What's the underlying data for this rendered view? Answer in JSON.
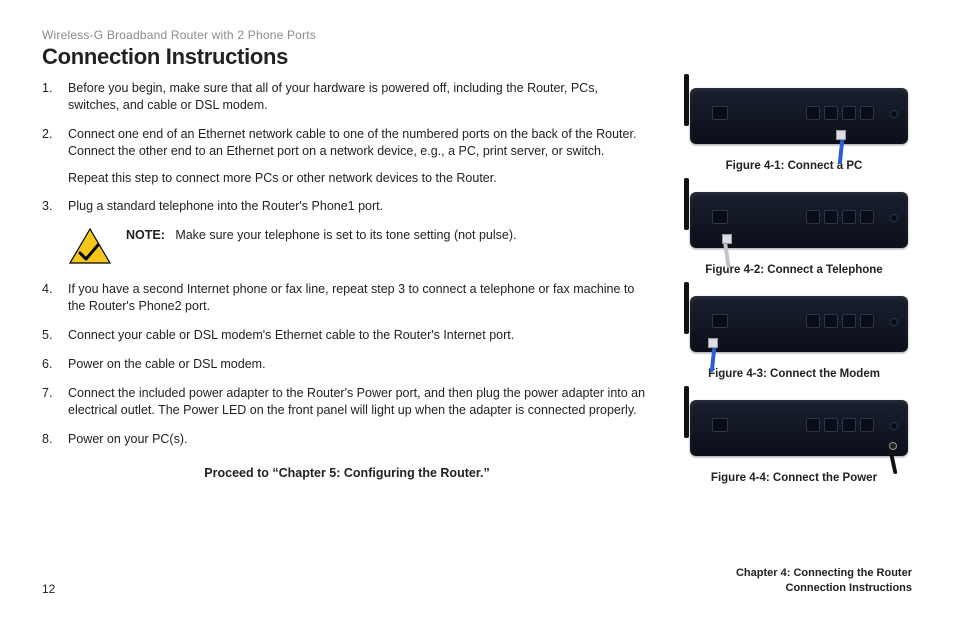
{
  "header": {
    "product": "Wireless-G Broadband Router with 2 Phone Ports",
    "title": "Connection Instructions"
  },
  "steps": {
    "s1": "Before you begin, make sure that all of your hardware is powered off, including the Router, PCs, switches, and cable or DSL modem.",
    "s2": "Connect one end of an Ethernet network cable to one of the numbered ports on the back of the Router. Connect the other end to an Ethernet port on a network device, e.g., a PC, print server, or switch.",
    "s2b": "Repeat this step to connect more PCs or other network devices to the Router.",
    "s3": "Plug a standard telephone into the Router's Phone1 port.",
    "note_label": "NOTE:",
    "note_text": "Make sure your telephone is set to its tone setting (not pulse).",
    "s4": "If you have a second Internet phone or fax line, repeat step 3 to connect a telephone or fax machine to the Router's Phone2 port.",
    "s5": "Connect your cable or DSL modem's Ethernet cable to the Router's Internet port.",
    "s6": "Power on the cable or DSL modem.",
    "s7": "Connect the included power adapter to the Router's Power port, and then plug the power adapter into an electrical outlet. The Power LED on the front panel will light up when the adapter is connected properly.",
    "s8": "Power on your PC(s).",
    "proceed": "Proceed to “Chapter 5: Configuring the Router.”"
  },
  "figures": {
    "f1": "Figure 4-1: Connect a PC",
    "f2": "Figure 4-2: Connect a Telephone",
    "f3": "Figure 4-3: Connect the Modem",
    "f4": "Figure 4-4: Connect the Power"
  },
  "footer": {
    "page": "12",
    "chapter": "Chapter 4: Connecting the Router",
    "section": "Connection Instructions"
  }
}
